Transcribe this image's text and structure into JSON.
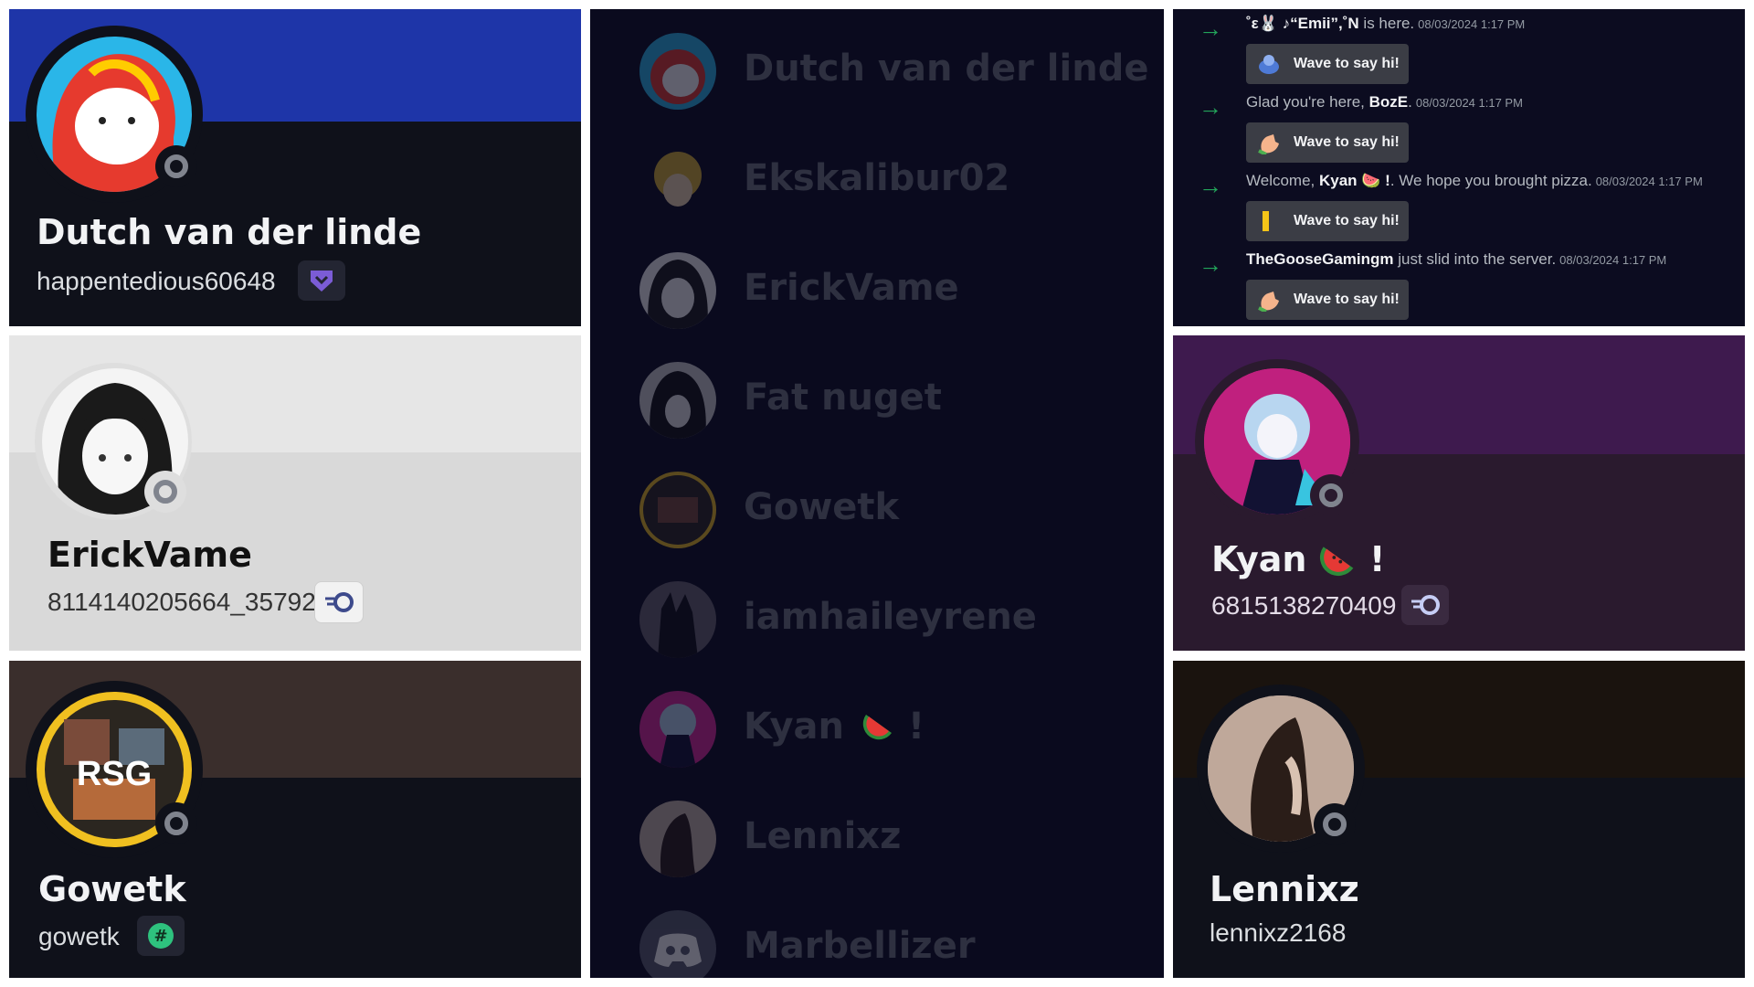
{
  "cards": [
    {
      "display_name": "Dutch van der linde",
      "username": "happentedious60648",
      "badge_icon": "hypesquad-balance-icon",
      "banner_color": "#1e35a8"
    },
    {
      "display_name": "ErickVame",
      "username": "8114140205664_35792",
      "badge_icon": "quest-badge-icon",
      "banner_color": "#dcdcdc"
    },
    {
      "display_name": "Gowetk",
      "username": "gowetk",
      "badge_icon": "hashtag-badge-icon",
      "banner_color": "#3a2e2c"
    },
    {
      "display_name": "Kyan",
      "display_suffix": "!",
      "username": "6815138270409",
      "badge_icon": "quest-badge-icon",
      "banner_color": "#3e1a4e"
    },
    {
      "display_name": "Lennixz",
      "username": "lennixz2168",
      "banner_color": "#1a130e"
    }
  ],
  "member_list": [
    {
      "name": "Dutch van der linde"
    },
    {
      "name": "Ekskalibur02"
    },
    {
      "name": "ErickVame"
    },
    {
      "name": "Fat nuget"
    },
    {
      "name": "Gowetk"
    },
    {
      "name": "iamhaileyrene"
    },
    {
      "name": "Kyan",
      "suffix": "!"
    },
    {
      "name": "Lennixz"
    },
    {
      "name": "Marbellizer"
    }
  ],
  "join_feed": [
    {
      "pre": "",
      "user": "˚ε🐰 ♪“Emii”,˚N",
      "post": " is here.",
      "time": "08/03/2024 1:17 PM",
      "button": "Wave to say hi!"
    },
    {
      "pre": "Glad you're here, ",
      "user": "BozE",
      "post": ".",
      "time": "08/03/2024 1:17 PM",
      "button": "Wave to say hi!"
    },
    {
      "pre": "Welcome, ",
      "user": "Kyan 🍉 !",
      "post": ". We hope you brought pizza.",
      "time": "08/03/2024 1:17 PM",
      "button": "Wave to say hi!"
    },
    {
      "pre": "",
      "user": "TheGooseGamingm",
      "post": " just slid into the server.",
      "time": "08/03/2024 1:17 PM",
      "button": "Wave to say hi!"
    }
  ]
}
